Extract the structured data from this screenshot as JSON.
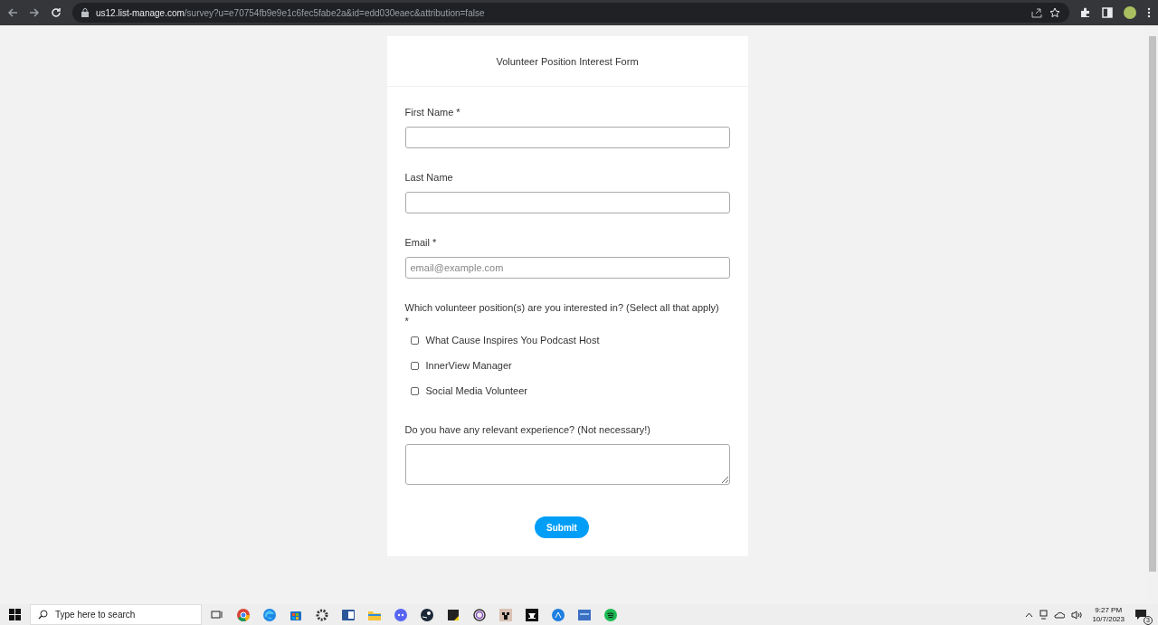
{
  "browser": {
    "url_host": "us12.list-manage.com",
    "url_path": "/survey?u=e70754fb9e9e1c6fec5fabe2a&id=edd030eaec&attribution=false"
  },
  "form": {
    "title": "Volunteer Position Interest Form",
    "fields": [
      {
        "kind": "text",
        "label": "First Name",
        "required_mark": "*"
      },
      {
        "kind": "text",
        "label": "Last Name"
      },
      {
        "kind": "text",
        "label": "Email",
        "required_mark": "*",
        "placeholder": "email@example.com"
      },
      {
        "kind": "checkboxes",
        "label": "Which volunteer position(s) are you interested in? (Select all that apply)",
        "required_mark": "*",
        "options": [
          {
            "label": "What Cause Inspires You Podcast Host",
            "checked": false
          },
          {
            "label": "InnerView Manager",
            "checked": false
          },
          {
            "label": "Social Media Volunteer",
            "checked": false
          }
        ]
      },
      {
        "kind": "textarea",
        "label": "Do you have any relevant experience? (Not necessary!)"
      }
    ],
    "submit": "Submit"
  },
  "taskbar": {
    "search_placeholder": "Type here to search",
    "time": "9:27 PM",
    "date": "10/7/2023",
    "notification_count": "3"
  }
}
